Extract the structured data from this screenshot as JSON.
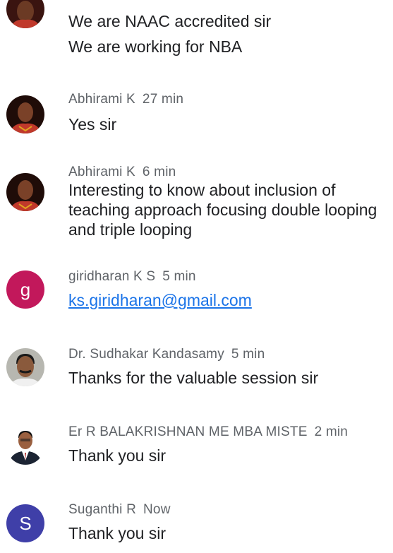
{
  "chat": {
    "messages": [
      {
        "author": "",
        "time": "",
        "avatar": "photo-woman",
        "lines": [
          "We are NAAC accredited sir",
          "We are working for NBA"
        ]
      },
      {
        "author": "Abhirami K",
        "time": "27 min",
        "avatar": "photo-woman",
        "lines": [
          "Yes sir"
        ]
      },
      {
        "author": "Abhirami K",
        "time": "6 min",
        "avatar": "photo-woman",
        "lines": [
          "Interesting to know about inclusion of",
          "teaching approach focusing double looping",
          "and triple looping"
        ]
      },
      {
        "author": "giridharan K S",
        "time": "5 min",
        "avatar_letter": "g",
        "avatar_color": "#c2185b",
        "link": "ks.giridharan@gmail.com"
      },
      {
        "author": "Dr. Sudhakar Kandasamy",
        "time": "5 min",
        "avatar": "photo-man",
        "lines": [
          "Thanks for the valuable session sir"
        ]
      },
      {
        "author": "Er R BALAKRISHNAN ME MBA MISTE",
        "time": "2 min",
        "avatar": "photo-man-suit",
        "lines": [
          "Thank you sir"
        ]
      },
      {
        "author": "Suganthi R",
        "time": "Now",
        "avatar_letter": "S",
        "avatar_color": "#3f3fa8",
        "lines": [
          "Thank you sir"
        ]
      }
    ]
  },
  "colors": {
    "author_text": "#5f6368",
    "body_text": "#202124",
    "link": "#1a73e8"
  }
}
